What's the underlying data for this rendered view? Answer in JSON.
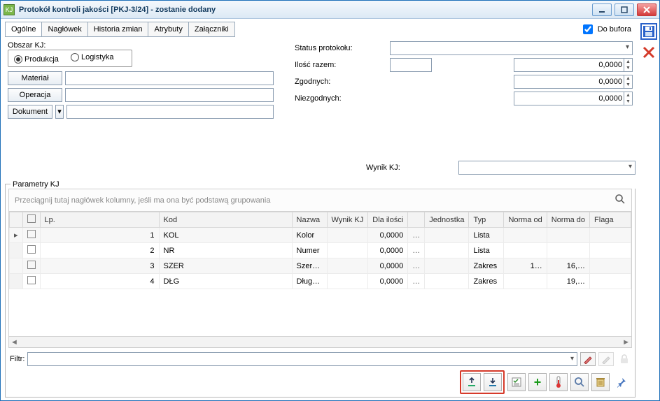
{
  "window": {
    "title": "Protokół kontroli jakości [PKJ-3/24] - zostanie dodany"
  },
  "buffer": {
    "label": "Do bufora"
  },
  "tabs": [
    "Ogólne",
    "Nagłówek",
    "Historia zmian",
    "Atrybuty",
    "Załączniki"
  ],
  "area": {
    "label": "Obszar KJ:",
    "options": {
      "prod": "Produkcja",
      "log": "Logistyka"
    }
  },
  "left_buttons": {
    "material": "Materiał",
    "operation": "Operacja",
    "document": "Dokument"
  },
  "right_form": {
    "status_label": "Status protokołu:",
    "ilosc_label": "Ilość razem:",
    "zgodnych_label": "Zgodnych:",
    "niezgodnych_label": "Niezgodnych:",
    "wynik_label": "Wynik KJ:",
    "value": "0,0000"
  },
  "params": {
    "legend": "Parametry KJ",
    "group_hint": "Przeciągnij tutaj nagłówek kolumny, jeśli ma ona być podstawą grupowania",
    "columns": {
      "lp": "Lp.",
      "kod": "Kod",
      "nazwa": "Nazwa",
      "wynik": "Wynik KJ",
      "dla": "Dla ilości",
      "jedn": "Jednostka",
      "typ": "Typ",
      "nod": "Norma od",
      "ndo": "Norma do",
      "flaga": "Flaga"
    },
    "rows": [
      {
        "lp": "1",
        "kod": "KOL",
        "nazwa": "Kolor",
        "dla": "0,0000",
        "typ": "Lista",
        "nod": "",
        "ndo": ""
      },
      {
        "lp": "2",
        "kod": "NR",
        "nazwa": "Numer",
        "dla": "0,0000",
        "typ": "Lista",
        "nod": "",
        "ndo": ""
      },
      {
        "lp": "3",
        "kod": "SZER",
        "nazwa": "Szer…",
        "dla": "0,0000",
        "typ": "Zakres",
        "nod": "1…",
        "ndo": "16,…"
      },
      {
        "lp": "4",
        "kod": "DŁG",
        "nazwa": "Dług…",
        "dla": "0,0000",
        "typ": "Zakres",
        "nod": "",
        "ndo": "19,…"
      }
    ]
  },
  "filter": {
    "label": "Filtr:"
  }
}
